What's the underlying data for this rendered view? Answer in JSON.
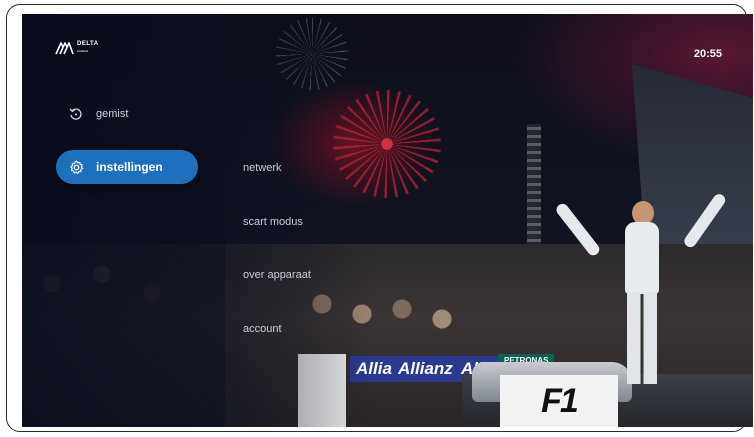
{
  "app": {
    "logo_text": "DELTA",
    "logo_subtext": "mobiel",
    "clock": "20:55"
  },
  "sidebar": {
    "items": [
      {
        "label": "gemist",
        "icon": "replay-icon",
        "active": false
      },
      {
        "label": "instellingen",
        "icon": "gear-icon",
        "active": true
      }
    ]
  },
  "settings_menu": {
    "items": [
      {
        "label": "netwerk"
      },
      {
        "label": "scart modus"
      },
      {
        "label": "over apparaat"
      },
      {
        "label": "account"
      }
    ]
  },
  "background": {
    "banner_1": "Allianz",
    "banner_2": "Allianz",
    "banner_3": "Allianz",
    "banner_4": "PETRONAS",
    "podium_logo": "F1"
  },
  "colors": {
    "accent": "#1f6fbf",
    "sidebar_bg": "#0a0e1e",
    "text": "#ffffff"
  }
}
